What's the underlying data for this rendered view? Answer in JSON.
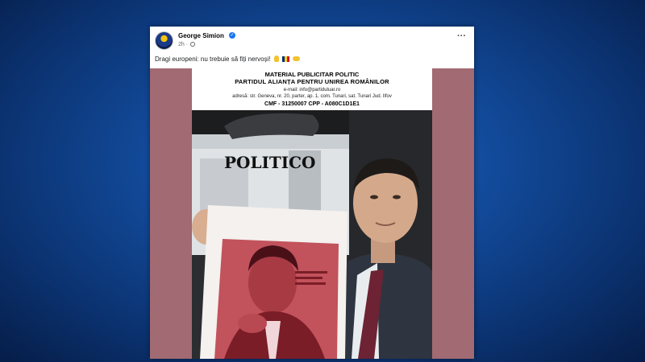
{
  "post": {
    "author": "George Simion",
    "time": "2h",
    "meta_separator": "·",
    "text": "Dragi europeni: nu trebuie să fiți nervoși!",
    "more_label": "···",
    "verified_mark": "✓",
    "icons": [
      "avatar",
      "verified-icon",
      "globe-icon",
      "more-icon",
      "hand-emoji",
      "romania-flag-emoji",
      "handshake-emoji"
    ]
  },
  "image": {
    "disclaimer_line1": "MATERIAL PUBLICITAR POLITIC",
    "disclaimer_line2": "PARTIDUL ALIANȚA PENTRU UNIREA ROMÂNILOR",
    "disclaimer_email": "e-mail: info@partiduluar.ro",
    "disclaimer_address": "adresă: str. Geneva, nr. 20, parter, ap. 1, com. Tunari, sat. Tunari Jud. Ilfov",
    "disclaimer_ids": "CMF - 31250007    CPP - A080C1D1E1",
    "magazine_name": "POLITICO"
  },
  "colors": {
    "background": "#124a9a",
    "media_frame": "#a26a72",
    "magazine_cover": "#c2525c",
    "verified": "#1877f2"
  }
}
